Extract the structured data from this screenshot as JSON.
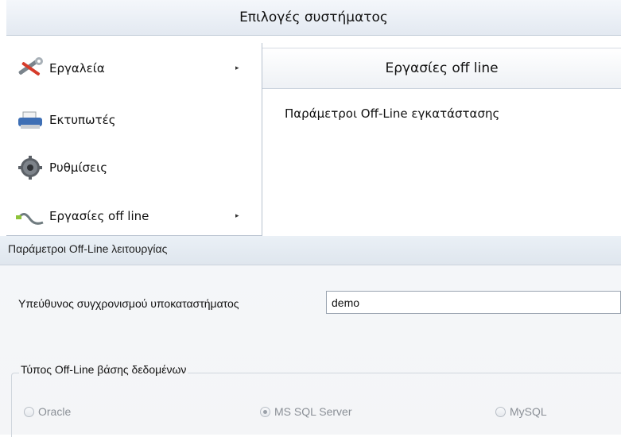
{
  "window": {
    "title": "Επιλογές συστήματος"
  },
  "menu": {
    "items": [
      {
        "label": "Εργαλεία",
        "icon": "tools-icon",
        "has_submenu": true
      },
      {
        "label": "Εκτυπωτές",
        "icon": "printer-icon",
        "has_submenu": false
      },
      {
        "label": "Ρυθμίσεις",
        "icon": "gear-icon",
        "has_submenu": false
      },
      {
        "label": "Εργασίες off line",
        "icon": "cable-icon",
        "has_submenu": true
      }
    ]
  },
  "panel": {
    "header": "Εργασίες off line",
    "items": [
      "Παράμετροι Off-Line εγκατάστασης"
    ]
  },
  "dialog": {
    "title": "Παράμετροι Off-Line λειτουργίας",
    "sync_label": "Υπεύθυνος συγχρονισμού υποκαταστήματος",
    "sync_value": "demo",
    "db_group_label": "Τύπος Off-Line βάσης δεδομένων",
    "db_options": [
      {
        "label": "Oracle",
        "selected": false
      },
      {
        "label": "MS SQL Server",
        "selected": true
      },
      {
        "label": "MySQL",
        "selected": false
      }
    ]
  }
}
